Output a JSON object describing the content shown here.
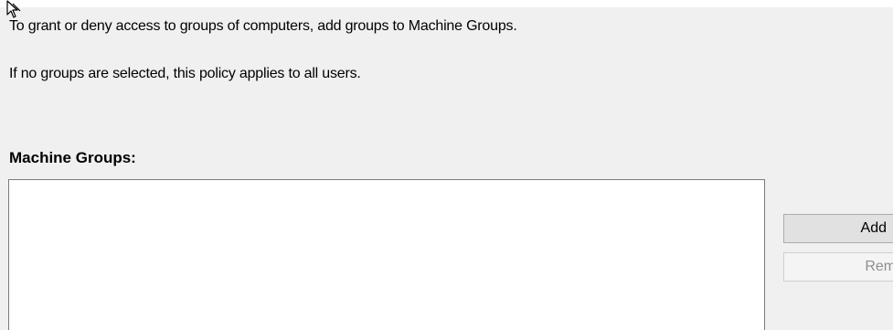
{
  "description": {
    "line1": "To grant or deny access to groups of computers, add groups to Machine Groups.",
    "line2": "If no groups are selected, this policy applies to all users."
  },
  "machine_groups": {
    "label": "Machine Groups:",
    "items": []
  },
  "buttons": {
    "add_label": "Add",
    "remove_label": "Remo",
    "remove_enabled": false
  },
  "icons": {
    "cursor": "move-cursor-icon"
  },
  "colors": {
    "panel_background": "#f0f0f0",
    "list_background": "#ffffff",
    "disabled_text": "#8f8f8f"
  }
}
